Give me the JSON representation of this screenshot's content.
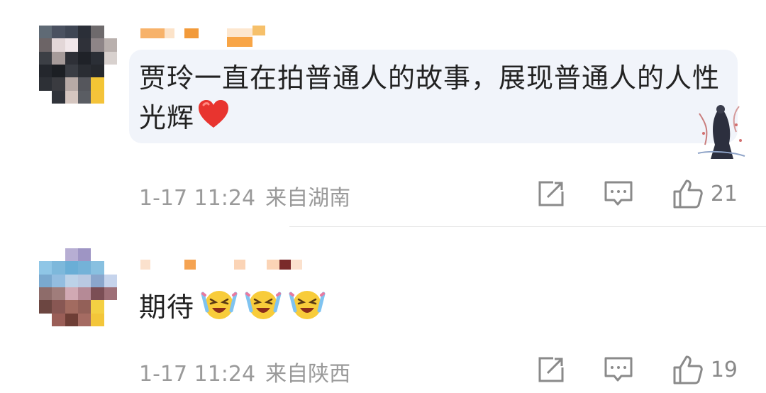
{
  "comments": [
    {
      "text": "贾玲一直在拍普通人的故事，展现普通人的人性光辉",
      "time": "1-17 11:24",
      "location": "来自湖南",
      "likes": "21",
      "emoji": "red-heart"
    },
    {
      "text": "期待",
      "time": "1-17 11:24",
      "location": "来自陕西",
      "likes": "19",
      "emoji": "tears-of-joy"
    }
  ],
  "colors": {
    "bubble": "#f1f4fa",
    "text": "#222222",
    "meta": "#9a9a9a",
    "icon": "#8a8a8a",
    "name_pixel": "#f0a030"
  },
  "icons": [
    "share-icon",
    "comment-icon",
    "like-icon",
    "red-heart-emoji",
    "laughing-emoji"
  ]
}
